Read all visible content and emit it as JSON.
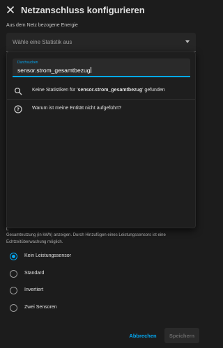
{
  "header": {
    "title": "Netzanschluss konfigurieren",
    "close_icon": "close-icon"
  },
  "section": {
    "label": "Aus dem Netz bezogene Energie"
  },
  "select": {
    "placeholder": "Wähle eine Statistik aus",
    "caret_icon": "chevron-down-icon"
  },
  "popup": {
    "search_label": "Durchsuchen",
    "search_value": "sensor.strom_gesamtbezug",
    "no_results_prefix": "Keine Statistiken für '",
    "no_results_term": "sensor.strom_gesamtbezug",
    "no_results_suffix": "' gefunden",
    "help_text": "Warum ist meine Entität nicht aufgeführt?"
  },
  "partial_label": "L",
  "description": "Gesamtnutzung (in kWh) anzeigen. Durch Hinzufügen eines Leistungssensors ist eine Echtzeitüberwachung möglich.",
  "radio_options": [
    {
      "label": "Kein Leistungssensor",
      "checked": true
    },
    {
      "label": "Standard",
      "checked": false
    },
    {
      "label": "Invertiert",
      "checked": false
    },
    {
      "label": "Zwei Sensoren",
      "checked": false
    }
  ],
  "footer": {
    "cancel": "Abbrechen",
    "save": "Speichern"
  },
  "colors": {
    "accent": "#03a9f4",
    "background": "#1c1c1c",
    "surface": "#262626"
  }
}
